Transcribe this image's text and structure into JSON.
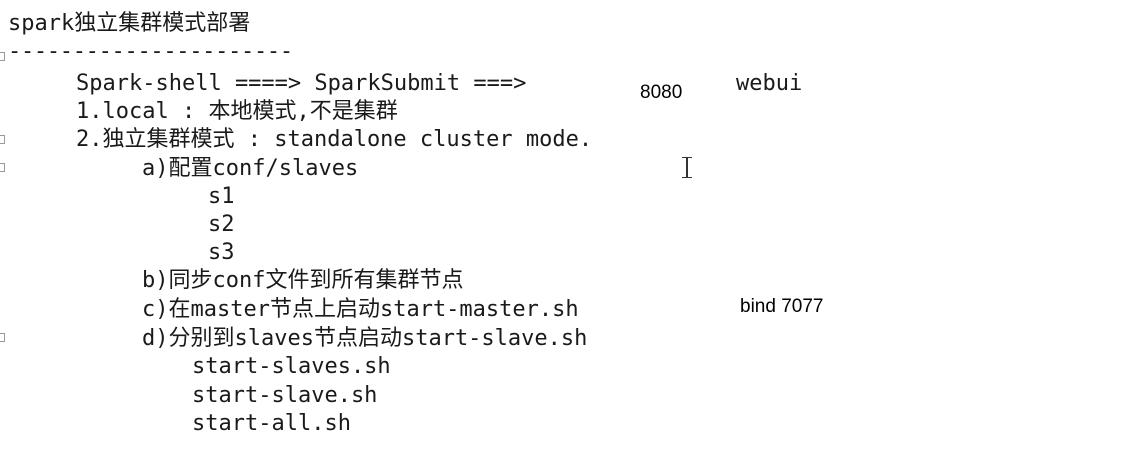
{
  "doc": {
    "title": "spark独立集群模式部署",
    "separator": "----------------------",
    "line_shell": "Spark-shell ====> SparkSubmit ===>",
    "anno_port": "8080",
    "anno_webui": "webui",
    "line_local": "1.local : 本地模式,不是集群",
    "line_standalone": "2.独立集群模式 : standalone cluster mode.",
    "step_a": "a)配置conf/slaves",
    "slaves": [
      "s1",
      "s2",
      "s3"
    ],
    "step_b": "b)同步conf文件到所有集群节点",
    "step_c": "c)在master节点上启动start-master.sh",
    "anno_bind": "bind 7077",
    "step_d": "d)分别到slaves节点启动start-slave.sh",
    "scripts": [
      "start-slaves.sh",
      "start-slave.sh",
      "start-all.sh"
    ]
  },
  "icons": {
    "cursor": "text-cursor-icon",
    "gutter": "fold-marker-icon"
  }
}
